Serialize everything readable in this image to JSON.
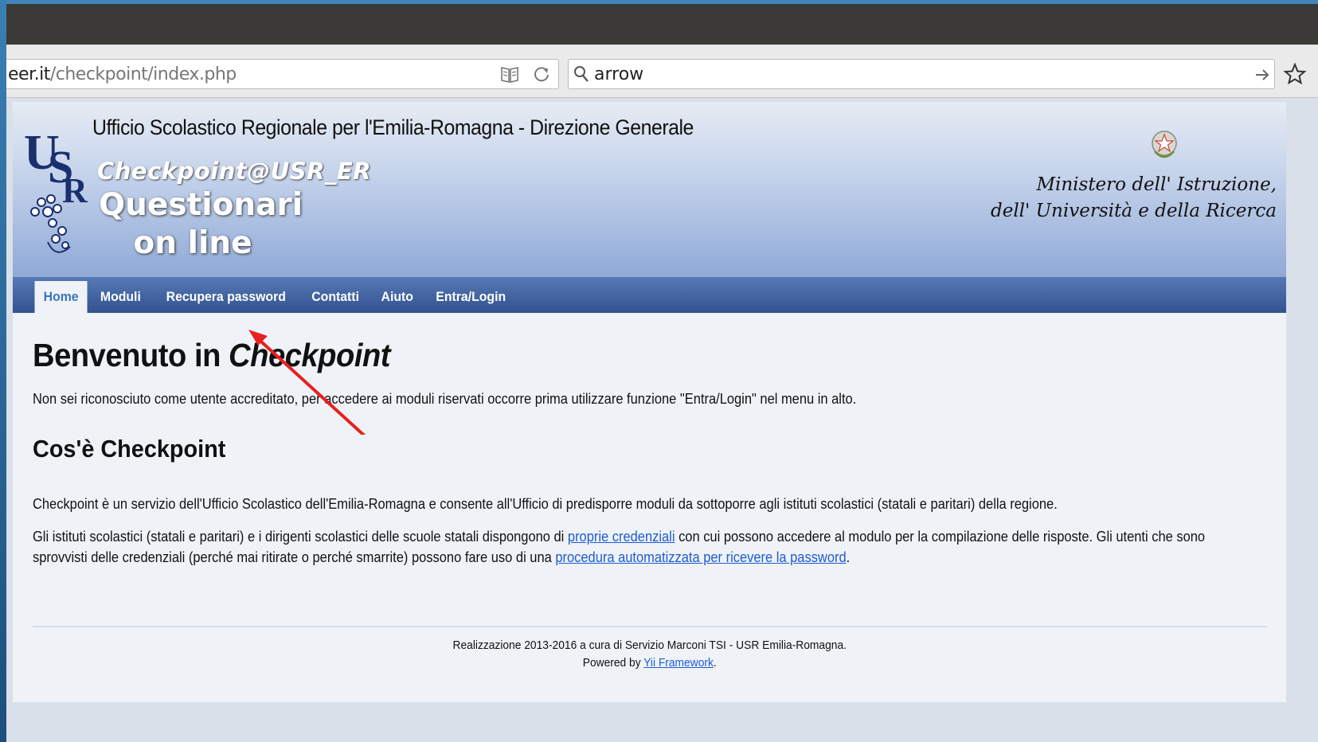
{
  "browser": {
    "url_host": "eer.it",
    "url_path": "/checkpoint/index.php",
    "search_value": "arrow"
  },
  "header": {
    "office_title": "Ufficio Scolastico Regionale per l'Emilia-Romagna - Direzione Generale",
    "brand": "Checkpoint@USR_ER",
    "questionari_line1": "Questionari",
    "questionari_line2": "on line",
    "ministry_line1": "Ministero dell' Istruzione,",
    "ministry_line2": "dell' Università e della Ricerca"
  },
  "menu": {
    "items": [
      {
        "label": "Home",
        "active": true
      },
      {
        "label": "Moduli"
      },
      {
        "label": "Recupera password"
      },
      {
        "label": "Contatti"
      },
      {
        "label": "Aiuto"
      },
      {
        "label": "Entra/Login"
      }
    ]
  },
  "content": {
    "welcome_prefix": "Benvenuto in ",
    "welcome_em": "Checkpoint",
    "not_recognized": "Non sei riconosciuto come utente accreditato, per accedere ai moduli riservati occorre prima utilizzare funzione \"Entra/Login\" nel menu in alto.",
    "what_title": "Cos'è Checkpoint",
    "what_para": "Checkpoint è un servizio dell'Ufficio Scolastico dell'Emilia-Romagna e consente all'Ufficio di predisporre moduli da sottoporre agli istituti scolastici (statali e paritari) della regione.",
    "cred_part1": "Gli istituti scolastici (statali e paritari) e i dirigenti scolastici delle scuole statali dispongono di ",
    "cred_link1": "proprie credenziali",
    "cred_part2": " con cui possono accedere al modulo per la compilazione delle risposte. Gli utenti che sono sprovvisti delle credenziali (perché mai ritirate o perché smarrite) possono fare uso di una ",
    "cred_link2": "procedura automatizzata per ricevere la password",
    "cred_part3": "."
  },
  "footer": {
    "line1": "Realizzazione 2013-2016 a cura di Servizio Marconi TSI - USR Emilia-Romagna.",
    "powered_prefix": "Powered by ",
    "powered_link": "Yii Framework",
    "powered_suffix": "."
  },
  "colors": {
    "menu_bg": "#32528f",
    "link": "#1f5bd0",
    "annotation_arrow": "#e8201f"
  },
  "icons": [
    "reader-view-icon",
    "reload-icon",
    "search-icon",
    "go-arrow-icon",
    "bookmark-star-icon",
    "usr-logo",
    "republic-emblem"
  ]
}
